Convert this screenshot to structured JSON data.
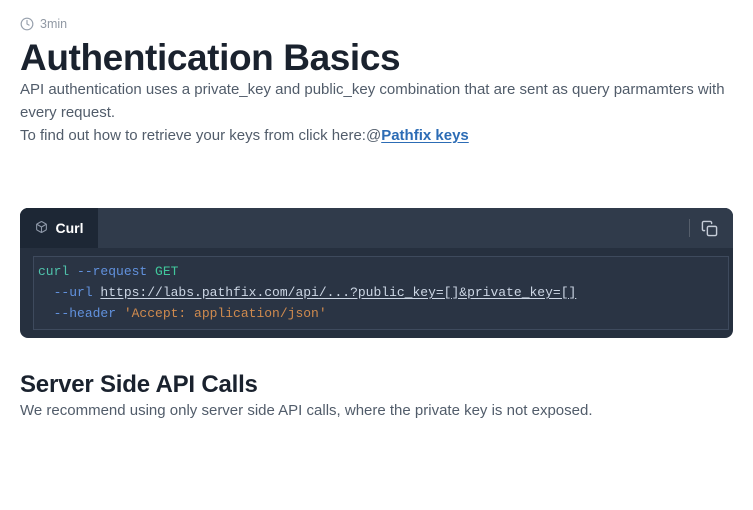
{
  "meta": {
    "read_time": "3min"
  },
  "page": {
    "title": "Authentication Basics"
  },
  "intro": {
    "paragraph1": "API authentication uses a private_key and public_key combination that are sent as query parmamters with every request.",
    "paragraph2_prefix": "To find out how to retrieve your keys from click here:@",
    "link_label": "Pathfix keys"
  },
  "colors": {
    "link": "#2c6cb5",
    "code_command": "#4fc2ab",
    "code_flag": "#6191dd",
    "code_keyword": "#41c79c",
    "code_url": "#ccd6e4",
    "code_string": "#cf8a4e",
    "code_plain": "#c9d3e1",
    "code_block_bg": "#26303f",
    "code_header_bg": "#303b4b",
    "code_tab_bg": "#1d2735"
  },
  "code_block": {
    "tab_label": "Curl",
    "tab_icon": "cube-icon",
    "copy_icon": "copy-icon",
    "lines": [
      [
        {
          "t": "curl ",
          "c": "command"
        },
        {
          "t": "--request ",
          "c": "flag"
        },
        {
          "t": "GET",
          "c": "keyword"
        }
      ],
      [
        {
          "t": "  ",
          "c": "plain"
        },
        {
          "t": "--url ",
          "c": "flag"
        },
        {
          "t": "https://labs.pathfix.com/api/...?public_key=[]&private_key=[]",
          "c": "url",
          "u": true
        }
      ],
      [
        {
          "t": "  ",
          "c": "plain"
        },
        {
          "t": "--header ",
          "c": "flag"
        },
        {
          "t": "'Accept: application/json'",
          "c": "string"
        }
      ]
    ]
  },
  "section2": {
    "title": "Server Side API Calls",
    "paragraph": "We recommend using only server side API calls, where the private key is not exposed."
  }
}
